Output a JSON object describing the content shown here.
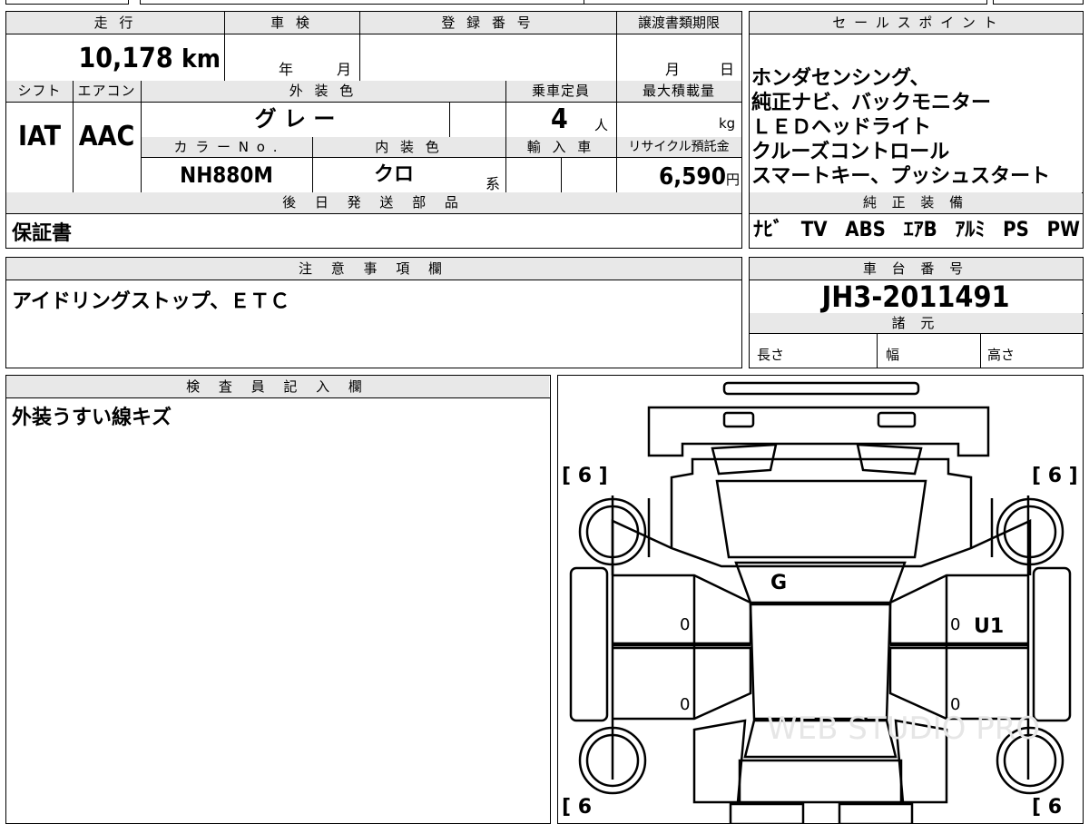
{
  "main_table": {
    "mileage_label": "走 行",
    "mileage_value": "10,178",
    "mileage_unit": "km",
    "inspection_label": "車 検",
    "inspection_year": "年",
    "inspection_month": "月",
    "registration_label": "登 録 番 号",
    "transfer_label": "譲渡書類期限",
    "transfer_month": "月",
    "transfer_day": "日",
    "shift_label": "シフト",
    "shift_value": "IAT",
    "aircon_label": "エアコン",
    "aircon_value": "AAC",
    "exterior_color_label": "外 装 色",
    "exterior_color_value": "グ レ ー",
    "capacity_label": "乗車定員",
    "capacity_value": "4",
    "capacity_unit": "人",
    "max_load_label": "最大積載量",
    "max_load_unit": "kg",
    "color_no_label": "カ ラ ー N o .",
    "color_no_value": "NH880M",
    "interior_color_label": "内 装 色",
    "interior_color_value": "クロ",
    "interior_color_suffix": "系",
    "import_label": "輸 入 車",
    "recycle_label": "リサイクル預託金",
    "recycle_value": "6,590",
    "recycle_unit": "円",
    "later_parts_label": "後 日 発 送 部 品",
    "later_parts_value": "保証書"
  },
  "notes": {
    "label": "注 意 事 項 欄",
    "value": "アイドリングストップ、ＥＴＣ"
  },
  "inspector": {
    "label": "検 査 員 記 入 欄",
    "value": "外装うすい線キズ"
  },
  "sales_point": {
    "label": "セ ー ル ス ポ イ ン ト",
    "lines": [
      "ホンダセンシング、",
      "純正ナビ、バックモニター",
      "ＬＥＤヘッドライト",
      "クルーズコントロール",
      "スマートキー、プッシュスタート"
    ]
  },
  "genuine_equipment": {
    "label": "純 正 装 備",
    "items": [
      "ﾅﾋﾞ",
      "TV",
      "ABS",
      "ｴｱB",
      "ｱﾙﾐ",
      "PS",
      "PW"
    ]
  },
  "chassis": {
    "label": "車 台 番 号",
    "value": "JH3-2011491",
    "spec_label": "諸 元",
    "length_label": "長さ",
    "width_label": "幅",
    "height_label": "高さ"
  },
  "diagram": {
    "tire_front_left": "[ 6 ]",
    "tire_front_right": "[ 6 ]",
    "tire_rear_left": "[ 6",
    "tire_rear_right": "[ 6",
    "roof_mark": "G",
    "right_door_mark": "U1",
    "left_front_door_zero": "0",
    "left_rear_door_zero": "0",
    "right_front_door_zero": "0",
    "right_rear_door_zero": "0",
    "watermark": "WEB STUDIO PRO"
  }
}
